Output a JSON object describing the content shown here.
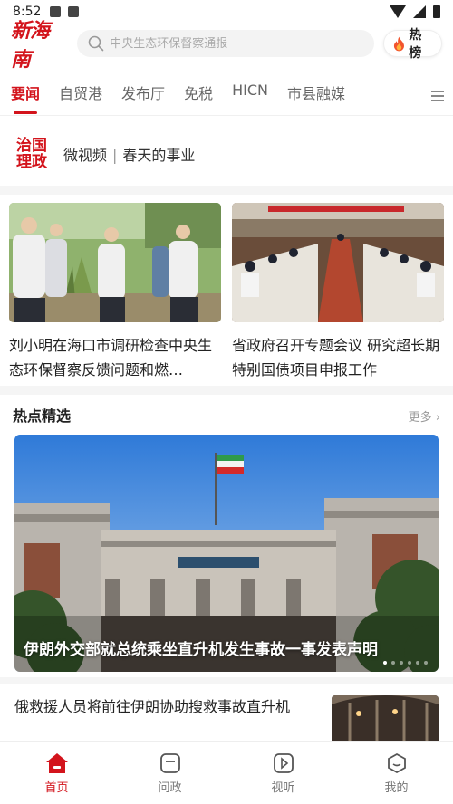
{
  "status": {
    "time": "8:52"
  },
  "header": {
    "logo": "新海南",
    "search_placeholder": "中央生态环保督察通报",
    "hot_label": "热榜"
  },
  "tabs": [
    "要闻",
    "自贸港",
    "发布厅",
    "免税",
    "HICN",
    "市县融媒"
  ],
  "banner": {
    "badge_line1": "治国",
    "badge_line2": "理政",
    "left": "微视频",
    "sep": "|",
    "right": "春天的事业"
  },
  "top_news": [
    {
      "title": "刘小明在海口市调研检查中央生态环保督察反馈问题和燃…"
    },
    {
      "title": "省政府召开专题会议 研究超长期特别国债项目申报工作"
    }
  ],
  "hot_section": {
    "title": "热点精选",
    "more": "更多 ›",
    "feature_caption": "伊朗外交部就总统乘坐直升机发生事故一事发表声明"
  },
  "list_item": {
    "title": "俄救援人员将前往伊朗协助搜救事故直升机"
  },
  "bottom_nav": [
    "首页",
    "问政",
    "视听",
    "我的"
  ],
  "colors": {
    "accent": "#d3141c"
  }
}
